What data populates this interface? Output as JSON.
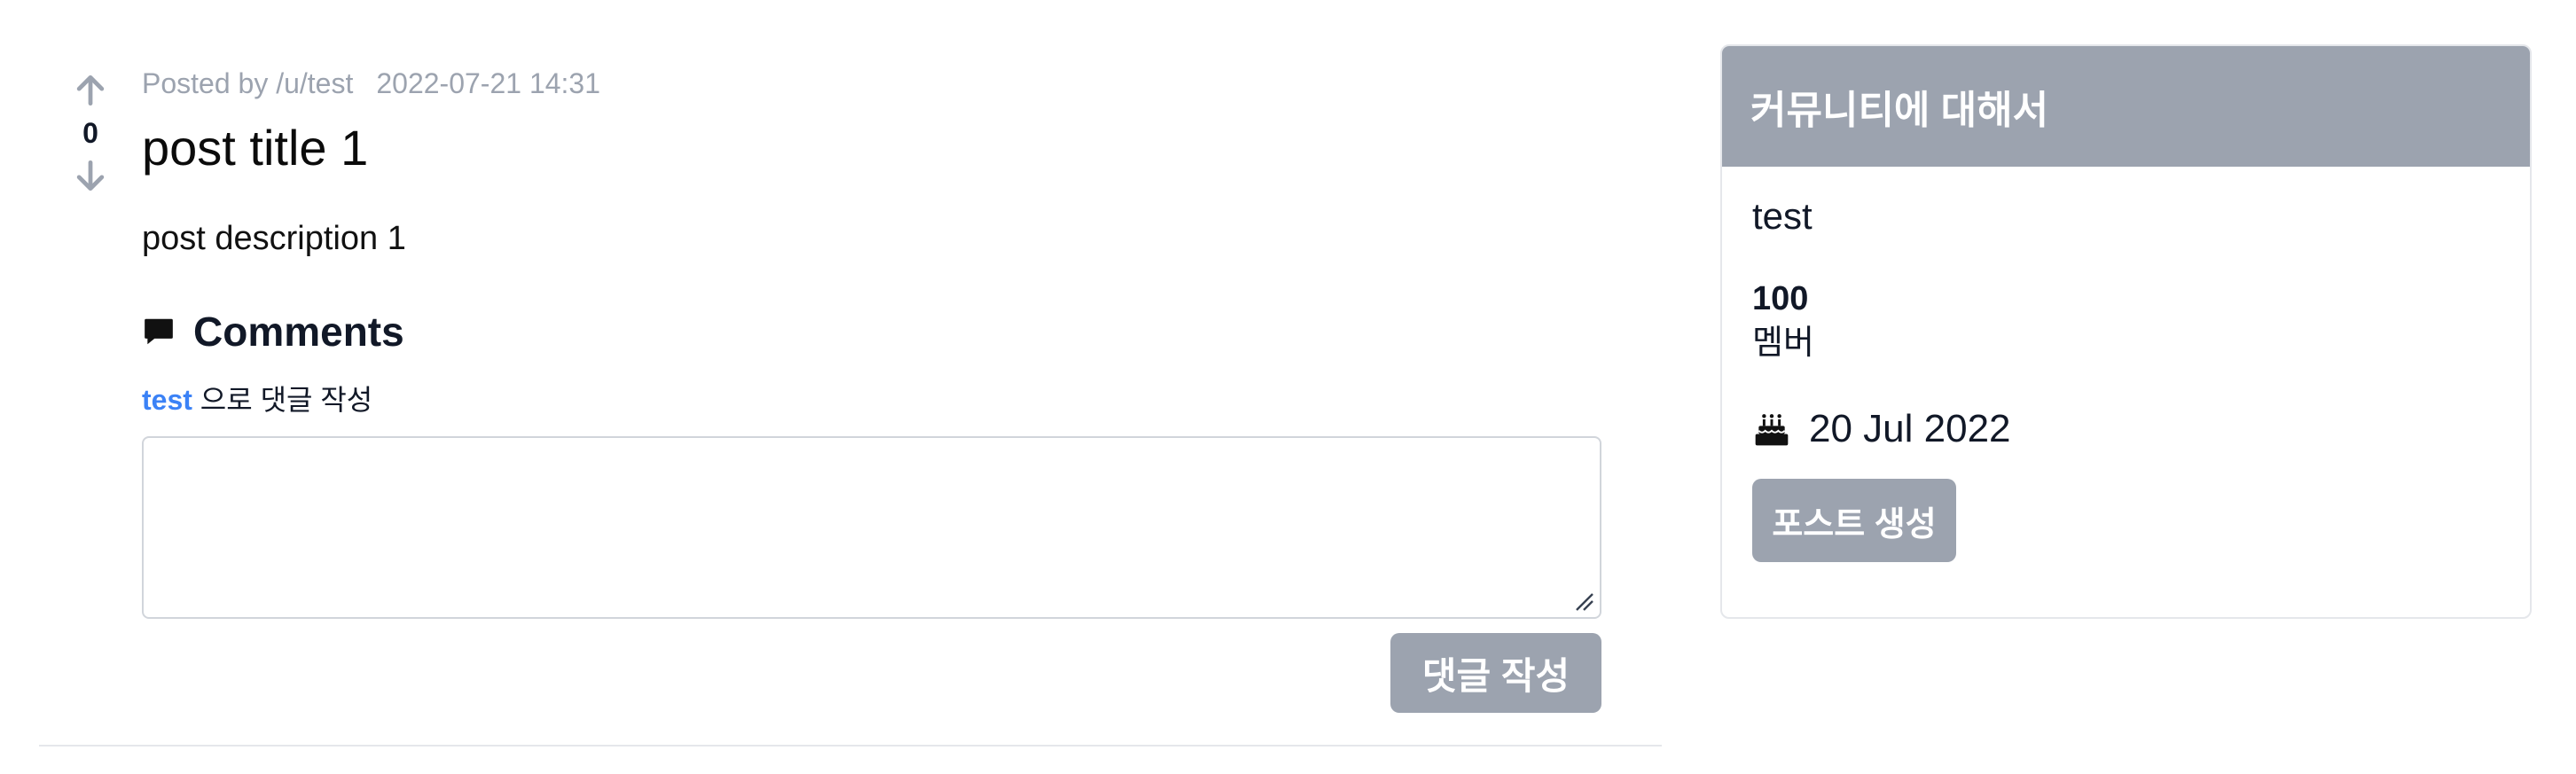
{
  "post": {
    "vote_count": "0",
    "posted_by": "Posted by /u/test",
    "timestamp": "2022-07-21 14:31",
    "title": "post title 1",
    "description": "post description 1"
  },
  "comments": {
    "heading": "Comments",
    "author": "test",
    "author_suffix": " 으로 댓글 작성",
    "textarea_value": "",
    "submit_label": "댓글 작성"
  },
  "sidebar": {
    "header": "커뮤니티에 대해서",
    "community_name": "test",
    "member_count": "100",
    "member_label": "멤버",
    "created_date": "20 Jul 2022",
    "create_post_label": "포스트 생성"
  },
  "icons": {
    "upvote": "arrow-up-icon",
    "downvote": "arrow-down-icon",
    "comments": "comment-icon",
    "created": "cake-icon"
  },
  "colors": {
    "accent_gray": "#9ca3af",
    "link_blue": "#3b82f6",
    "border": "#d1d5db"
  }
}
